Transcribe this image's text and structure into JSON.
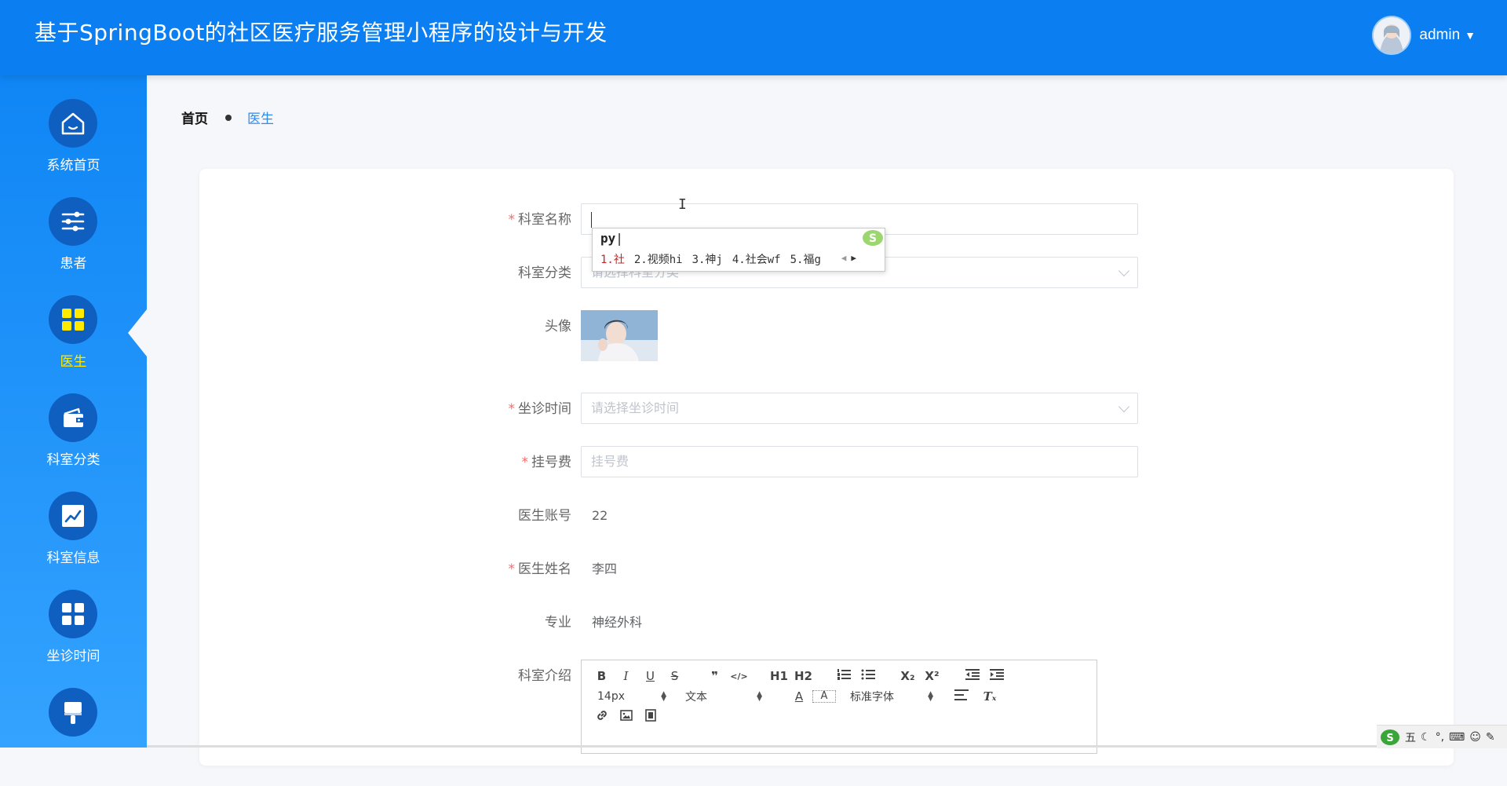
{
  "header": {
    "title": "基于SpringBoot的社区医疗服务管理小程序的设计与开发",
    "username": "admin"
  },
  "sidebar": {
    "items": [
      {
        "label": "系统首页",
        "icon": "home-icon"
      },
      {
        "label": "患者",
        "icon": "sliders-icon"
      },
      {
        "label": "医生",
        "icon": "grid-icon",
        "active": true
      },
      {
        "label": "科室分类",
        "icon": "wallet-icon"
      },
      {
        "label": "科室信息",
        "icon": "chart-icon"
      },
      {
        "label": "坐诊时间",
        "icon": "grid-icon"
      },
      {
        "label": "",
        "icon": "brush-icon"
      }
    ]
  },
  "breadcrumb": {
    "home": "首页",
    "current": "医生"
  },
  "form": {
    "dept_name": {
      "label": "科室名称",
      "required": true,
      "value": ""
    },
    "dept_category": {
      "label": "科室分类",
      "placeholder": "请选择科室分类"
    },
    "avatar": {
      "label": "头像"
    },
    "schedule": {
      "label": "坐诊时间",
      "required": true,
      "placeholder": "请选择坐诊时间"
    },
    "fee": {
      "label": "挂号费",
      "required": true,
      "placeholder": "挂号费"
    },
    "account": {
      "label": "医生账号",
      "value": "22"
    },
    "name": {
      "label": "医生姓名",
      "required": true,
      "value": "李四"
    },
    "specialty": {
      "label": "专业",
      "value": "神经外科"
    },
    "intro": {
      "label": "科室介绍"
    }
  },
  "ime": {
    "composition": "py",
    "candidates": [
      "1.社",
      "2.视频hi",
      "3.神j",
      "4.社会wf",
      "5.福g"
    ]
  },
  "editor_toolbar": {
    "row1": [
      "B",
      "I",
      "U",
      "S",
      "❞",
      "</>",
      "H1",
      "H2",
      "list-ordered",
      "list-bullet",
      "X₂",
      "X²",
      "indent-decrease",
      "indent-increase"
    ],
    "font_size": "14px",
    "header_select": "文本",
    "font_family": "标准字体"
  },
  "tray": {
    "ime_mode": "五"
  },
  "colors": {
    "header": "#0b7ff2",
    "sidebar_top": "#0f86f5",
    "sidebar_bottom": "#34a3ff",
    "active_label": "#ffea00",
    "required": "#f56c6c"
  }
}
